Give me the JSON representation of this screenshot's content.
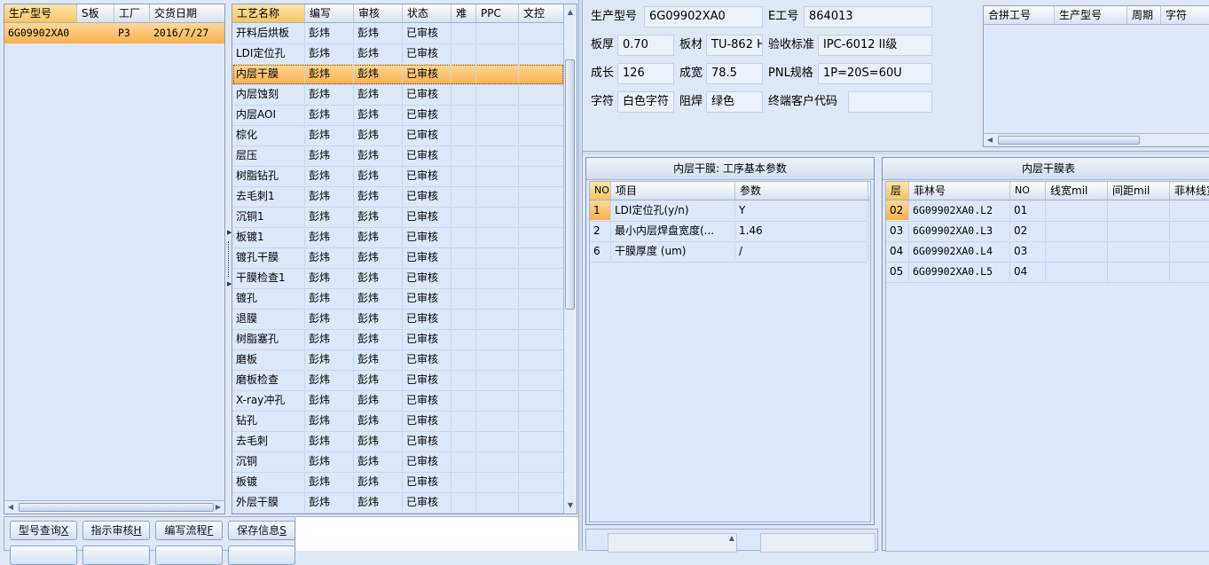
{
  "orders": {
    "columns": [
      "生产型号",
      "S板",
      "工厂",
      "交货日期"
    ],
    "rows": [
      {
        "model": "6G09902XA0",
        "s": "",
        "factory": "P3",
        "date": "2016/7/27"
      }
    ]
  },
  "process": {
    "columns": [
      "工艺名称",
      "编写",
      "审核",
      "状态",
      "难",
      "PPC",
      "文控"
    ],
    "rows": [
      {
        "name": "开料后烘板",
        "writer": "彭炜",
        "reviewer": "彭炜",
        "status": "已审核"
      },
      {
        "name": "LDI定位孔",
        "writer": "彭炜",
        "reviewer": "彭炜",
        "status": "已审核"
      },
      {
        "name": "内层干膜",
        "writer": "彭炜",
        "reviewer": "彭炜",
        "status": "已审核"
      },
      {
        "name": "内层蚀刻",
        "writer": "彭炜",
        "reviewer": "彭炜",
        "status": "已审核"
      },
      {
        "name": "内层AOI",
        "writer": "彭炜",
        "reviewer": "彭炜",
        "status": "已审核"
      },
      {
        "name": "棕化",
        "writer": "彭炜",
        "reviewer": "彭炜",
        "status": "已审核"
      },
      {
        "name": "层压",
        "writer": "彭炜",
        "reviewer": "彭炜",
        "status": "已审核"
      },
      {
        "name": "树脂钻孔",
        "writer": "彭炜",
        "reviewer": "彭炜",
        "status": "已审核"
      },
      {
        "name": "去毛刺1",
        "writer": "彭炜",
        "reviewer": "彭炜",
        "status": "已审核"
      },
      {
        "name": "沉铜1",
        "writer": "彭炜",
        "reviewer": "彭炜",
        "status": "已审核"
      },
      {
        "name": "板镀1",
        "writer": "彭炜",
        "reviewer": "彭炜",
        "status": "已审核"
      },
      {
        "name": "镀孔干膜",
        "writer": "彭炜",
        "reviewer": "彭炜",
        "status": "已审核"
      },
      {
        "name": "干膜检查1",
        "writer": "彭炜",
        "reviewer": "彭炜",
        "status": "已审核"
      },
      {
        "name": "镀孔",
        "writer": "彭炜",
        "reviewer": "彭炜",
        "status": "已审核"
      },
      {
        "name": "退膜",
        "writer": "彭炜",
        "reviewer": "彭炜",
        "status": "已审核"
      },
      {
        "name": "树脂塞孔",
        "writer": "彭炜",
        "reviewer": "彭炜",
        "status": "已审核"
      },
      {
        "name": "磨板",
        "writer": "彭炜",
        "reviewer": "彭炜",
        "status": "已审核"
      },
      {
        "name": "磨板检查",
        "writer": "彭炜",
        "reviewer": "彭炜",
        "status": "已审核"
      },
      {
        "name": "X-ray冲孔",
        "writer": "彭炜",
        "reviewer": "彭炜",
        "status": "已审核"
      },
      {
        "name": "钻孔",
        "writer": "彭炜",
        "reviewer": "彭炜",
        "status": "已审核"
      },
      {
        "name": "去毛刺",
        "writer": "彭炜",
        "reviewer": "彭炜",
        "status": "已审核"
      },
      {
        "name": "沉铜",
        "writer": "彭炜",
        "reviewer": "彭炜",
        "status": "已审核"
      },
      {
        "name": "板镀",
        "writer": "彭炜",
        "reviewer": "彭炜",
        "status": "已审核"
      },
      {
        "name": "外层干膜",
        "writer": "彭炜",
        "reviewer": "彭炜",
        "status": "已审核"
      }
    ],
    "selected_index": 2
  },
  "buttons": [
    {
      "label": "型号查询",
      "key": "X"
    },
    {
      "label": "指示审核",
      "key": "H"
    },
    {
      "label": "编写流程",
      "key": "F"
    },
    {
      "label": "保存信息",
      "key": "S"
    }
  ],
  "info": {
    "model_label": "生产型号",
    "model_value": "6G09902XA0",
    "eno_label": "E工号",
    "eno_value": "864013",
    "thickness_label": "板厚",
    "thickness_value": "0.70",
    "material_label": "板材",
    "material_value": "TU-862 H",
    "standard_label": "验收标准",
    "standard_value": "IPC-6012 II级",
    "length_label": "成长",
    "length_value": "126",
    "width_label": "成宽",
    "width_value": "78.5",
    "pnl_label": "PNL规格",
    "pnl_value": "1P=20S=60U",
    "legend_label": "字符",
    "legend_value": "白色字符",
    "mask_label": "阻焊",
    "mask_value": "绿色",
    "customer_label": "终端客户代码",
    "customer_value": ""
  },
  "merge": {
    "columns": [
      "合拼工号",
      "生产型号",
      "周期",
      "字符"
    ]
  },
  "params": {
    "title": "内层干膜: 工序基本参数",
    "columns": [
      "NO",
      "项目",
      "参数"
    ],
    "rows": [
      {
        "no": "1",
        "item": "LDI定位孔(y/n)",
        "value": "Y"
      },
      {
        "no": "2",
        "item": "最小内层焊盘宽度(...",
        "value": "1.46"
      },
      {
        "no": "6",
        "item": "干膜厚度 (um)",
        "value": "/"
      }
    ]
  },
  "film": {
    "title": "内层干膜表",
    "columns": [
      "层",
      "菲林号",
      "NO",
      "线宽mil",
      "间距mil",
      "菲林线宽"
    ],
    "rows": [
      {
        "layer": "02",
        "film": "6G09902XA0.L2",
        "no": "01"
      },
      {
        "layer": "03",
        "film": "6G09902XA0.L3",
        "no": "02"
      },
      {
        "layer": "04",
        "film": "6G09902XA0.L4",
        "no": "03"
      },
      {
        "layer": "05",
        "film": "6G09902XA0.L5",
        "no": "04"
      }
    ]
  }
}
